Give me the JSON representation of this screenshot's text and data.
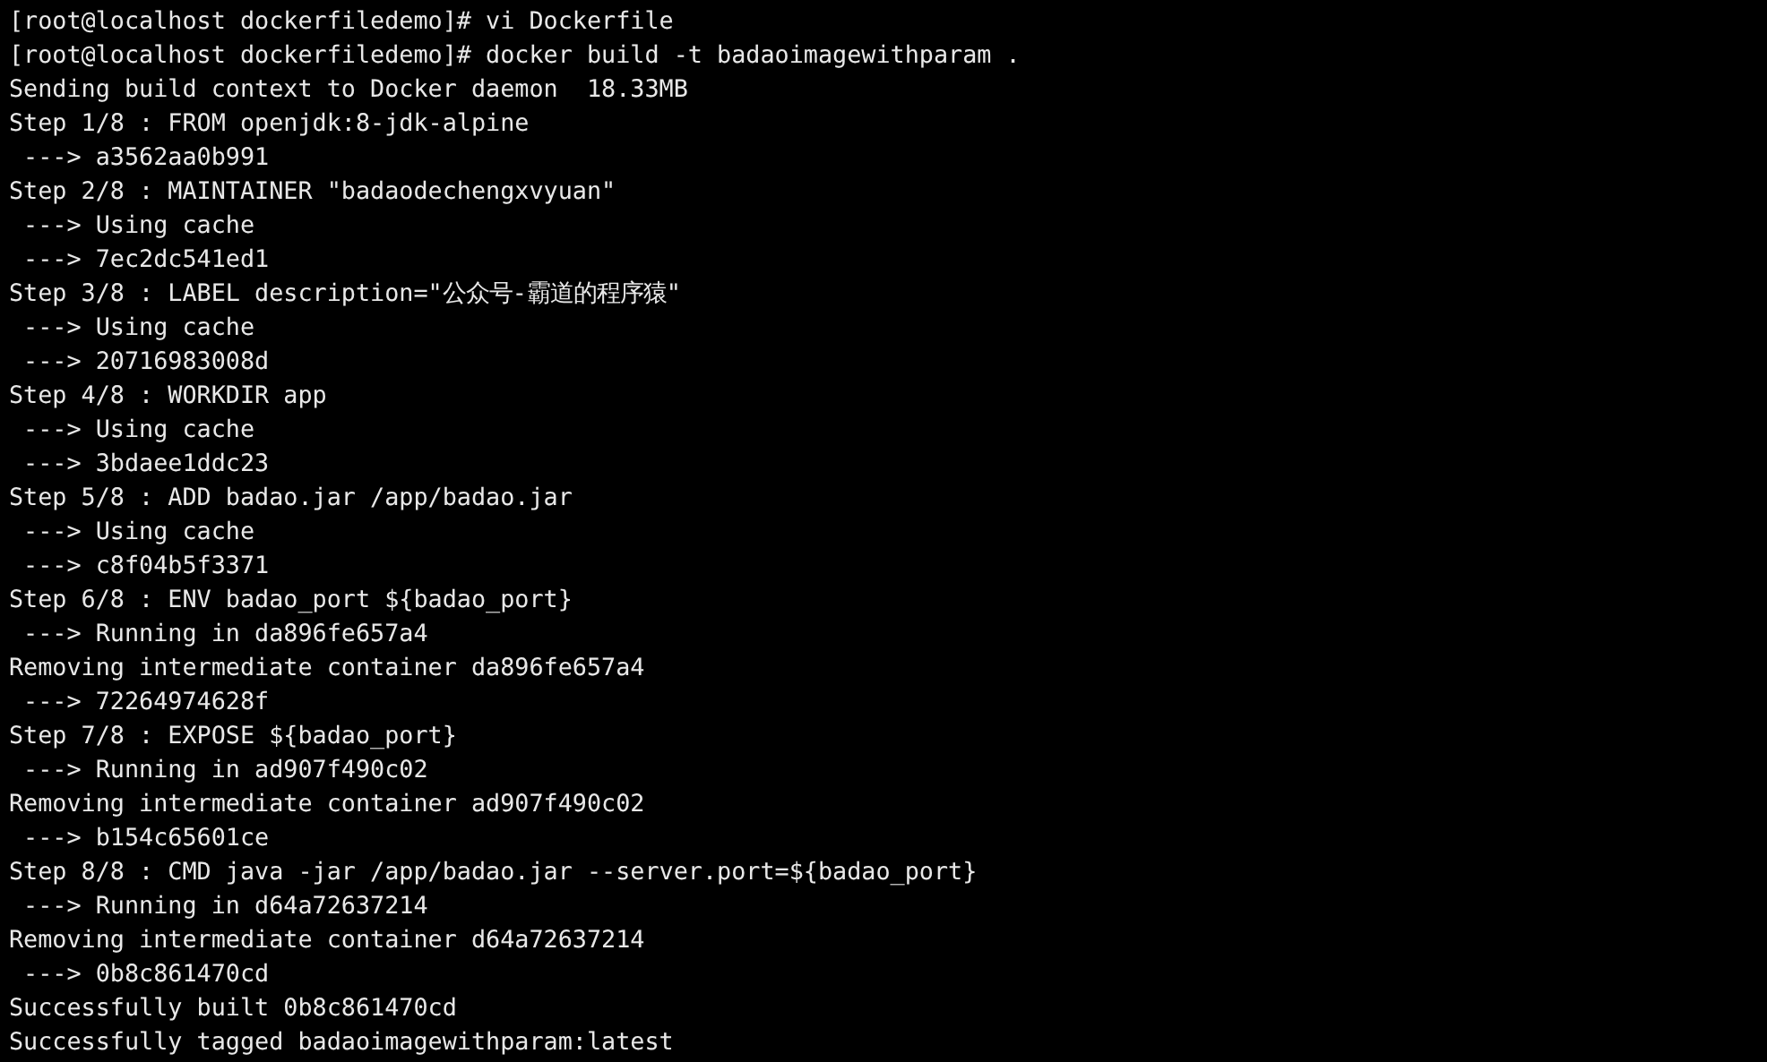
{
  "terminal": {
    "lines": [
      "[root@localhost dockerfiledemo]# vi Dockerfile",
      "[root@localhost dockerfiledemo]# docker build -t badaoimagewithparam .",
      "Sending build context to Docker daemon  18.33MB",
      "Step 1/8 : FROM openjdk:8-jdk-alpine",
      " ---> a3562aa0b991",
      "Step 2/8 : MAINTAINER \"badaodechengxvyuan\"",
      " ---> Using cache",
      " ---> 7ec2dc541ed1",
      "Step 3/8 : LABEL description=\"公众号-霸道的程序猿\"",
      " ---> Using cache",
      " ---> 20716983008d",
      "Step 4/8 : WORKDIR app",
      " ---> Using cache",
      " ---> 3bdaee1ddc23",
      "Step 5/8 : ADD badao.jar /app/badao.jar",
      " ---> Using cache",
      " ---> c8f04b5f3371",
      "Step 6/8 : ENV badao_port ${badao_port}",
      " ---> Running in da896fe657a4",
      "Removing intermediate container da896fe657a4",
      " ---> 72264974628f",
      "Step 7/8 : EXPOSE ${badao_port}",
      " ---> Running in ad907f490c02",
      "Removing intermediate container ad907f490c02",
      " ---> b154c65601ce",
      "Step 8/8 : CMD java -jar /app/badao.jar --server.port=${badao_port}",
      " ---> Running in d64a72637214",
      "Removing intermediate container d64a72637214",
      " ---> 0b8c861470cd",
      "Successfully built 0b8c861470cd",
      "Successfully tagged badaoimagewithparam:latest"
    ]
  }
}
